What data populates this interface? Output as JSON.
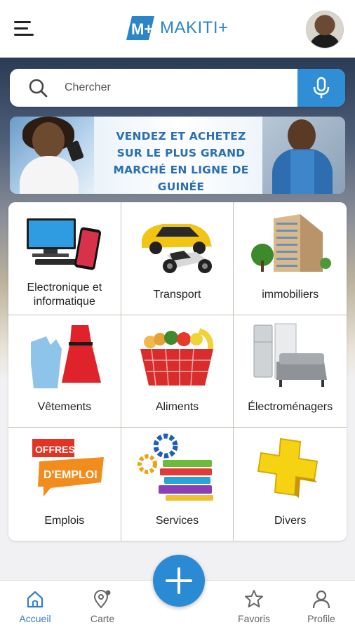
{
  "header": {
    "menu_icon": "hamburger-menu-icon",
    "logo_text": "MAKITI+",
    "logo_mark": "M+",
    "avatar_icon": "user-avatar"
  },
  "search": {
    "placeholder": "Chercher",
    "search_icon": "magnifier-icon",
    "mic_icon": "microphone-icon",
    "accent_color": "#2f8ed6"
  },
  "banner": {
    "line1": "VENDEZ ET ACHETEZ",
    "line2": "SUR LE PLUS GRAND",
    "line3": "MARCHÉ EN LIGNE DE GUINÉE",
    "text_color": "#2a6fb3"
  },
  "categories": [
    {
      "label": "Electronique et informatique",
      "icon": "computer-phone-icon"
    },
    {
      "label": "Transport",
      "icon": "car-motorbike-icon"
    },
    {
      "label": "immobiliers",
      "icon": "building-icon"
    },
    {
      "label": "Vêtements",
      "icon": "clothes-icon"
    },
    {
      "label": "Aliments",
      "icon": "grocery-basket-icon"
    },
    {
      "label": "Électroménagers",
      "icon": "fridge-sofa-icon"
    },
    {
      "label": "Emplois",
      "icon": "job-offers-icon",
      "art_line1": "OFFRES",
      "art_line2": "D'EMPLOI"
    },
    {
      "label": "Services",
      "icon": "books-gears-icon"
    },
    {
      "label": "Divers",
      "icon": "yellow-plus-icon"
    }
  ],
  "bottom_nav": {
    "items": [
      {
        "label": "Accueil",
        "icon": "home-icon",
        "active": true
      },
      {
        "label": "Carte",
        "icon": "map-pin-icon",
        "active": false
      },
      {
        "label": "Favoris",
        "icon": "star-icon",
        "active": false
      },
      {
        "label": "Profile",
        "icon": "person-icon",
        "active": false
      }
    ],
    "fab_icon": "plus-icon",
    "active_color": "#2f7fc7"
  }
}
